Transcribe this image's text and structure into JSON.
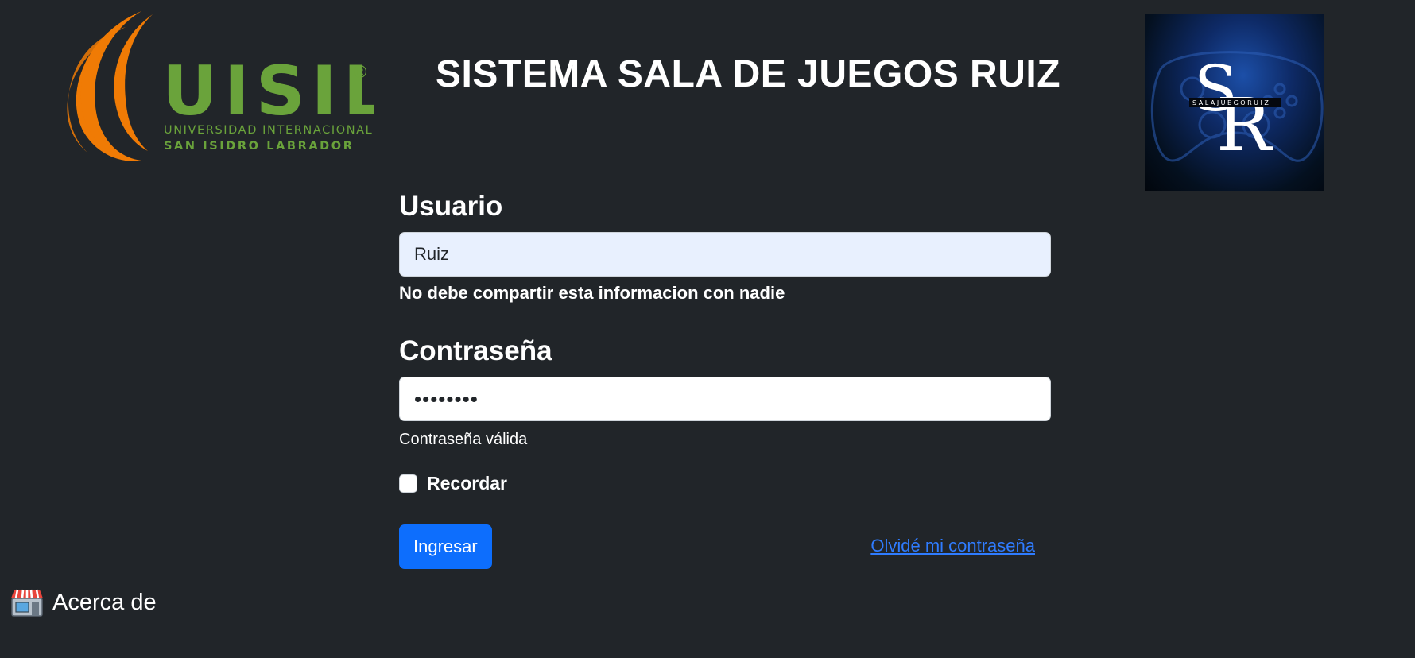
{
  "header": {
    "title": "SISTEMA SALA DE JUEGOS RUIZ",
    "uisil_logo": {
      "wordmark": "UISIL",
      "registered": "®",
      "line1": "UNIVERSIDAD INTERNACIONAL",
      "line2": "SAN ISIDRO LABRADOR",
      "colors": {
        "orange": "#f07b05",
        "green": "#6aa33b"
      }
    },
    "brand_logo": {
      "monogram_s": "S",
      "monogram_r": "R",
      "tagline": "SALAJUEGORUIZ"
    }
  },
  "form": {
    "username": {
      "label": "Usuario",
      "value": "Ruiz",
      "help": "No debe compartir esta informacion con nadie"
    },
    "password": {
      "label": "Contraseña",
      "masked_value": "••••••••",
      "feedback": "Contraseña válida"
    },
    "remember": {
      "label": "Recordar",
      "checked": false
    },
    "submit_label": "Ingresar",
    "forgot_label": "Olvidé mi contraseña"
  },
  "footer": {
    "about_label": "Acerca de",
    "about_icon": "store-icon"
  },
  "colors": {
    "background": "#212529",
    "primary": "#0d6efd",
    "link": "#2f7cff"
  }
}
